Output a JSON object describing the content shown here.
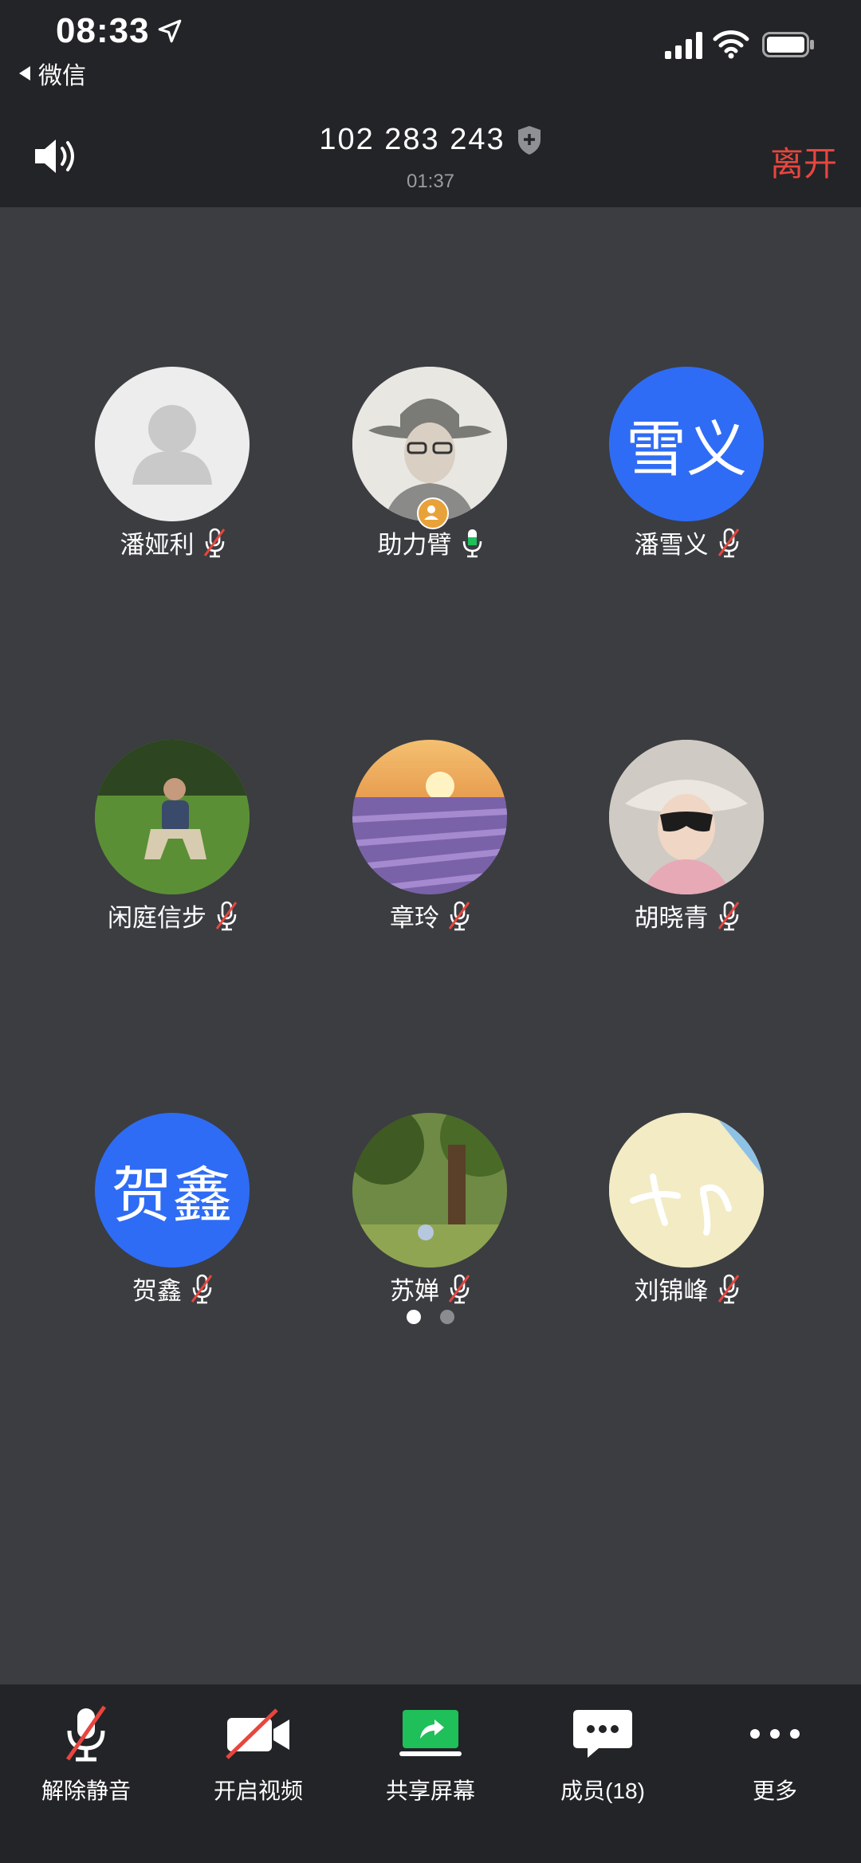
{
  "status_bar": {
    "time": "08:33",
    "back_label": "微信"
  },
  "header": {
    "meeting_id": "102 283 243",
    "duration": "01:37",
    "leave_label": "离开",
    "leave_color": "#e7463e"
  },
  "participants": [
    {
      "name": "潘娅利",
      "mic": "muted",
      "avatar": "default-avatar-icon"
    },
    {
      "name": "助力臂",
      "mic": "active",
      "avatar": "photo",
      "host": true
    },
    {
      "name": "潘雪义",
      "mic": "muted",
      "avatar": "text",
      "avatar_text": "雪义",
      "avatar_color": "#2f6cf5"
    },
    {
      "name": "闲庭信步",
      "mic": "muted",
      "avatar": "photo"
    },
    {
      "name": "章玲",
      "mic": "muted",
      "avatar": "photo"
    },
    {
      "name": "胡晓青",
      "mic": "muted",
      "avatar": "photo"
    },
    {
      "name": "贺鑫",
      "mic": "muted",
      "avatar": "text",
      "avatar_text": "贺鑫",
      "avatar_color": "#2f6cf5"
    },
    {
      "name": "苏婵",
      "mic": "muted",
      "avatar": "photo"
    },
    {
      "name": "刘锦峰",
      "mic": "muted",
      "avatar": "photo"
    }
  ],
  "pagination": {
    "pages": 2,
    "current": 1
  },
  "toolbar": {
    "unmute_label": "解除静音",
    "video_label": "开启视频",
    "share_label": "共享屏幕",
    "members_label": "成员(18)",
    "more_label": "更多",
    "share_color": "#1fbf5a"
  }
}
